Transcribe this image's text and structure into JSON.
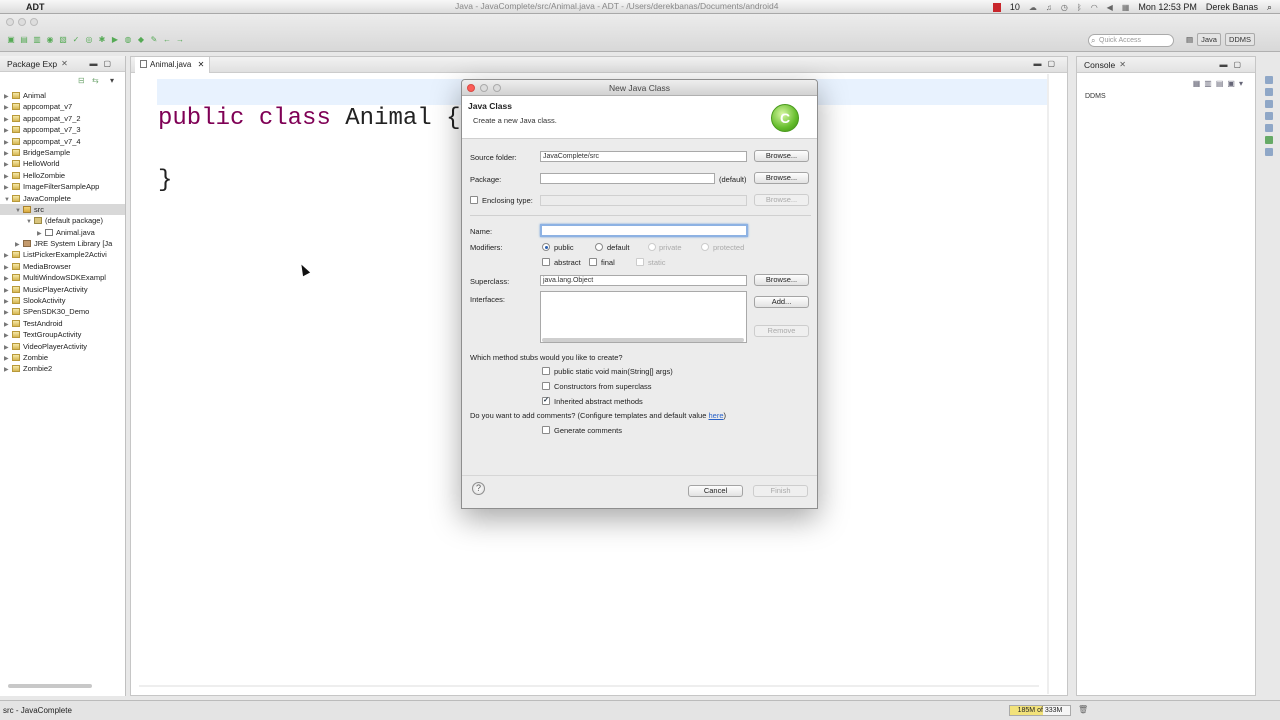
{
  "menubar": {
    "app_name": "ADT",
    "window_title": "Java - JavaComplete/src/Animal.java - ADT - /Users/derekbanas/Documents/android4",
    "badge_count": "10",
    "clock": "Mon 12:53 PM",
    "user": "Derek Banas"
  },
  "toolbar": {
    "quick_access_placeholder": "Quick Access",
    "perspective_java": "Java",
    "perspective_ddms": "DDMS"
  },
  "package_explorer": {
    "title": "Package Exp",
    "items": [
      {
        "label": "Animal",
        "icon": "project"
      },
      {
        "label": "appcompat_v7",
        "icon": "project"
      },
      {
        "label": "appcompat_v7_2",
        "icon": "project"
      },
      {
        "label": "appcompat_v7_3",
        "icon": "project"
      },
      {
        "label": "appcompat_v7_4",
        "icon": "project"
      },
      {
        "label": "BridgeSample",
        "icon": "project"
      },
      {
        "label": "HelloWorld",
        "icon": "project"
      },
      {
        "label": "HelloZombie",
        "icon": "project"
      },
      {
        "label": "ImageFilterSampleApp",
        "icon": "project"
      },
      {
        "label": "JavaComplete",
        "icon": "project",
        "expanded": true
      },
      {
        "label": "src",
        "icon": "source-folder",
        "expanded": true,
        "selected": true
      },
      {
        "label": "(default package)",
        "icon": "package",
        "expanded": true
      },
      {
        "label": "Animal.java",
        "icon": "java-file"
      },
      {
        "label": "JRE System Library [Ja",
        "icon": "library"
      },
      {
        "label": "ListPickerExample2Activi",
        "icon": "project"
      },
      {
        "label": "MediaBrowser",
        "icon": "project"
      },
      {
        "label": "MultiWindowSDKExampl",
        "icon": "project"
      },
      {
        "label": "MusicPlayerActivity",
        "icon": "project"
      },
      {
        "label": "SlookActivity",
        "icon": "project"
      },
      {
        "label": "SPenSDK30_Demo",
        "icon": "project"
      },
      {
        "label": "TestAndroid",
        "icon": "project"
      },
      {
        "label": "TextGroupActivity",
        "icon": "project"
      },
      {
        "label": "VideoPlayerActivity",
        "icon": "project"
      },
      {
        "label": "Zombie",
        "icon": "project"
      },
      {
        "label": "Zombie2",
        "icon": "project"
      }
    ]
  },
  "editor": {
    "tab_label": "Animal.java",
    "code_kw1": "public",
    "code_kw2": "class",
    "code_name": "Animal",
    "code_open": "{",
    "code_close": "}"
  },
  "console": {
    "title": "Console",
    "ddms_label": "DDMS"
  },
  "status": {
    "selection": "src - JavaComplete",
    "heap": "185M of 333M"
  },
  "dialog": {
    "title": "New Java Class",
    "header_title": "Java Class",
    "header_subtitle": "Create a new Java class.",
    "source_folder_label": "Source folder:",
    "source_folder_value": "JavaComplete/src",
    "package_label": "Package:",
    "package_value": "",
    "package_default": "(default)",
    "enclosing_type_label": "Enclosing type:",
    "name_label": "Name:",
    "name_value": "",
    "modifiers_label": "Modifiers:",
    "mod_public": "public",
    "mod_default": "default",
    "mod_private": "private",
    "mod_protected": "protected",
    "mod_abstract": "abstract",
    "mod_final": "final",
    "mod_static": "static",
    "superclass_label": "Superclass:",
    "superclass_value": "java.lang.Object",
    "interfaces_label": "Interfaces:",
    "browse": "Browse...",
    "add": "Add...",
    "remove": "Remove",
    "stubs_question": "Which method stubs would you like to create?",
    "stub_main": "public static void main(String[] args)",
    "stub_constructors": "Constructors from superclass",
    "stub_inherited": "Inherited abstract methods",
    "comments_question": "Do you want to add comments? (Configure templates and default value ",
    "comments_link": "here",
    "comments_close": ")",
    "generate_comments": "Generate comments",
    "cancel": "Cancel",
    "finish": "Finish"
  }
}
